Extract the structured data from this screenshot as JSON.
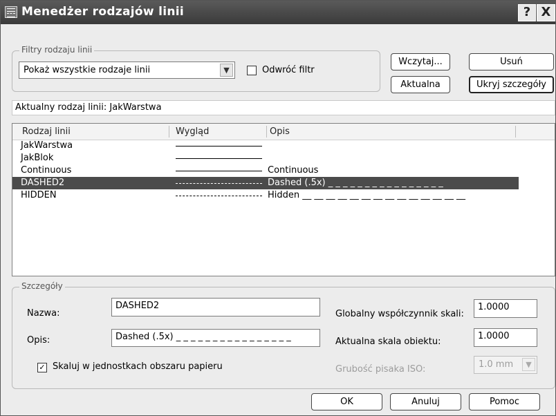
{
  "window": {
    "title": "Menedżer rodzajów linii",
    "help_label": "?",
    "close_label": "X"
  },
  "filters": {
    "group_label": "Filtry rodzaju linii",
    "selected": "Pokaż wszystkie rodzaje linii",
    "invert_label": "Odwróć filtr",
    "invert_checked": false
  },
  "buttons": {
    "load": "Wczytaj...",
    "delete": "Usuń",
    "current": "Aktualna",
    "hide_details": "Ukryj szczegóły",
    "ok": "OK",
    "cancel": "Anuluj",
    "help": "Pomoc"
  },
  "current_linetype": "Aktualny rodzaj linii:  JakWarstwa",
  "list": {
    "columns": [
      "Rodzaj linii",
      "Wygląd",
      "Opis"
    ],
    "rows": [
      {
        "name": "JakWarstwa",
        "appearance": "solid",
        "description": ""
      },
      {
        "name": "JakBlok",
        "appearance": "solid",
        "description": ""
      },
      {
        "name": "Continuous",
        "appearance": "solid",
        "description": "Continuous"
      },
      {
        "name": "DASHED2",
        "appearance": "dashed",
        "description": "Dashed (.5x) _ _ _ _ _ _ _ _ _ _ _ _ _ _ _ _",
        "selected": true
      },
      {
        "name": "HIDDEN",
        "appearance": "dashed",
        "description": "Hidden __ __ __ __ __ __ __ __ __ __ __ __ __ __"
      }
    ]
  },
  "details": {
    "group_label": "Szczegóły",
    "name_label": "Nazwa:",
    "name_value": "DASHED2",
    "desc_label": "Opis:",
    "desc_value": "Dashed (.5x) _ _ _ _ _ _ _ _ _ _ _ _ _ _ _ _",
    "global_scale_label": "Globalny współczynnik skali:",
    "global_scale_value": "1.0000",
    "object_scale_label": "Aktualna skala obiektu:",
    "object_scale_value": "1.0000",
    "iso_pen_label": "Grubość pisaka ISO:",
    "iso_pen_value": "1.0 mm",
    "paper_space_label": "Skaluj w jednostkach obszaru papieru",
    "paper_space_checked": true
  }
}
